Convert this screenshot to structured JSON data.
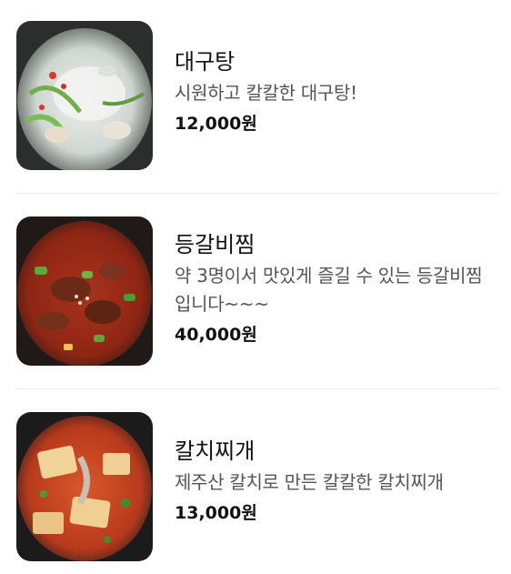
{
  "menu": {
    "items": [
      {
        "name": "대구탕",
        "description": "시원하고 칼칼한 대구탕!",
        "price": "12,000원",
        "image": "cod-stew-photo"
      },
      {
        "name": "등갈비찜",
        "description": "약 3명이서 맛있게 즐길 수 있는 등갈비찜입니다~~~",
        "price": "40,000원",
        "image": "braised-back-ribs-photo"
      },
      {
        "name": "칼치찌개",
        "description": "제주산 칼치로 만든 칼칼한 칼치찌개",
        "price": "13,000원",
        "image": "cutlassfish-stew-photo"
      }
    ]
  }
}
